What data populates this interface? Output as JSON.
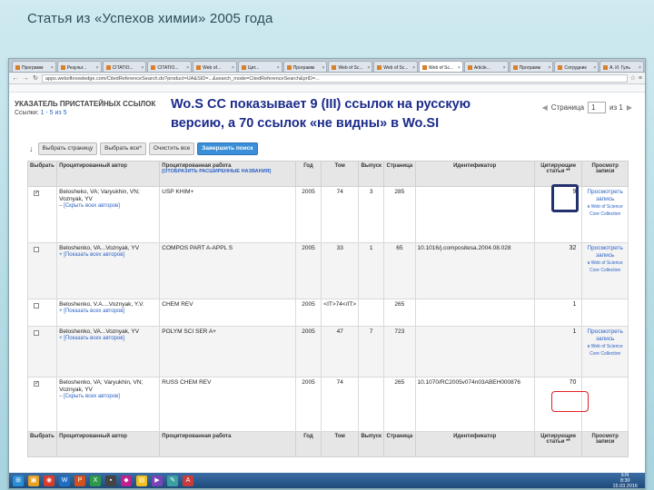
{
  "slide": {
    "title": "Статья из «Успехов химии» 2005 года"
  },
  "browser": {
    "tabs": [
      "Программ",
      "Результ...",
      "CITATIO...",
      "CITATIO...",
      "Web of...",
      "Цит...",
      "Программ",
      "Web of Sc...",
      "Web of Sc...",
      "Web of Sc...",
      "Article...",
      "Программ",
      "Сотрудник",
      "А. И. Гуль"
    ],
    "url": "apps.webofknowledge.com/CitedReferenceSearch.do?product=UA&SID=...&search_mode=CitedReferenceSearch&prID=..."
  },
  "page": {
    "index_title": "УКАЗАТЕЛЬ ПРИСТАТЕЙНЫХ ССЫЛОК",
    "links_label": "Ссылки:",
    "links_range": "1 - 5 из 5",
    "callout": "Wo.S CC показывает 9 (III) ссылок на русскую версию, а 70 ссылок «не видны» в Wo.SI",
    "pager": {
      "label": "Страница",
      "value": "1",
      "of": "из 1"
    },
    "actions": {
      "select_page": "Выбрать страницу",
      "select_all": "Выбрать все*",
      "clear_all": "Очистить все",
      "finish_search": "Завершить поиск"
    },
    "headers": {
      "select": "Выбрать",
      "cited_author": "Процитированный автор",
      "cited_work": "Процитированная работа",
      "show_expanded": "[ОТОБРАЗИТЬ РАСШИРЕННЫЕ НАЗВАНИЯ]",
      "year": "Год",
      "volume": "Том",
      "issue": "Выпуск",
      "page": "Страница",
      "identifier": "Идентификатор",
      "citing": "Цитирующие статьи **",
      "view": "Просмотр записи"
    },
    "rows": [
      {
        "checked": true,
        "authors": "Belosheko, VA; Varyukhin, VN; Voznyak, YV",
        "toggle": "– [Скрыть всех авторов]",
        "work": "USP KHIM+",
        "year": "2005",
        "volume": "74",
        "issue": "3",
        "page": "285",
        "identifier": "",
        "cites": "9",
        "view_main": "Просмотреть запись",
        "view_note": "в Web of Science Core Collection"
      },
      {
        "checked": false,
        "authors": "Beloshenko, VA...Voznyak, YV",
        "toggle": "+ [Показать всех авторов]",
        "work": "COMPOS PART A-APPL S",
        "year": "2005",
        "volume": "33",
        "issue": "1",
        "page": "65",
        "identifier": "10.1016/j.compositesa.2004.08.028",
        "cites": "32",
        "view_main": "Просмотреть запись",
        "view_note": "в Web of Science Core Collection"
      },
      {
        "checked": false,
        "authors": "Beloshenko, V.A....Voznyak, Y.V.",
        "toggle": "+ [Показать всех авторов]",
        "work": "CHEM REV",
        "year": "2005",
        "volume": "<IT>74</IT>",
        "issue": "",
        "page": "265",
        "identifier": "",
        "cites": "1",
        "view_main": "",
        "view_note": ""
      },
      {
        "checked": false,
        "authors": "Beloshenko, VA...Voznyak, YV",
        "toggle": "+ [Показать всех авторов]",
        "work": "POLYM SCI SER A+",
        "year": "2005",
        "volume": "47",
        "issue": "7",
        "page": "723",
        "identifier": "",
        "cites": "1",
        "view_main": "Просмотреть запись",
        "view_note": "в Web of Science Core Collection"
      },
      {
        "checked": true,
        "authors": "Beloshenko, VA; Varyukhin, VN; Voznyak, YV",
        "toggle": "– [Скрыть всех авторов]",
        "work": "RUSS CHEM REV",
        "year": "2005",
        "volume": "74",
        "issue": "",
        "page": "265",
        "identifier": "10.1070/RC2005v074n03ABEH000876",
        "cites": "70",
        "view_main": "",
        "view_note": ""
      }
    ],
    "taskbar": {
      "clock_time": "8:30",
      "clock_date": "15.03.2016",
      "lang": "EN"
    },
    "colors": {
      "highlight_red": "#e02020",
      "highlight_blue": "#23306e",
      "callout_text": "#1a2a8a",
      "link": "#2b62c4"
    }
  }
}
